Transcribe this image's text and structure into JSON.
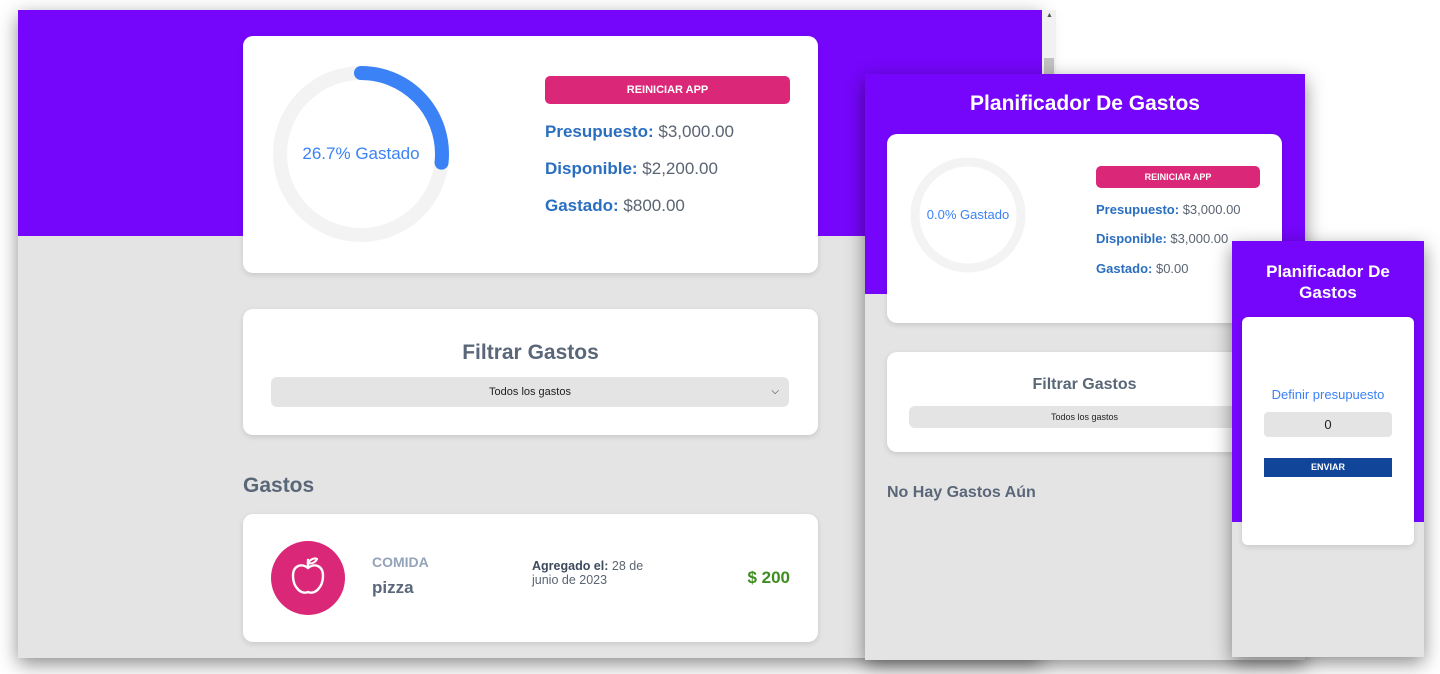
{
  "desktop": {
    "progress_fraction": 0.267,
    "progress_label": "26.7% Gastado",
    "reset_button": "REINICIAR APP",
    "budget_label": "Presupuesto:",
    "budget_value": "$3,000.00",
    "available_label": "Disponible:",
    "available_value": "$2,200.00",
    "spent_label": "Gastado:",
    "spent_value": "$800.00",
    "filter_title": "Filtrar Gastos",
    "filter_selected": "Todos los gastos",
    "expenses_title": "Gastos",
    "expense": {
      "category": "COMIDA",
      "name": "pizza",
      "date_label": "Agregado el:",
      "date_value": "28 de junio de 2023",
      "amount": "$ 200"
    }
  },
  "tablet": {
    "title": "Planificador De Gastos",
    "progress_fraction": 0.0,
    "progress_label": "0.0% Gastado",
    "reset_button": "REINICIAR APP",
    "budget_label": "Presupuesto:",
    "budget_value": "$3,000.00",
    "available_label": "Disponible:",
    "available_value": "$3,000.00",
    "spent_label": "Gastado:",
    "spent_value": "$0.00",
    "filter_title": "Filtrar Gastos",
    "filter_selected": "Todos los gastos",
    "empty_message": "No Hay Gastos Aún"
  },
  "mobile": {
    "title": "Planificador De Gastos",
    "budget_prompt": "Definir presupuesto",
    "budget_input_value": "0",
    "submit_button": "ENVIAR"
  },
  "colors": {
    "hero": "#7506fb",
    "accent_pink": "#db2777",
    "progress_blue": "#3b82f6",
    "label_blue": "#2a6ebf",
    "amount_green": "#3f8c1f",
    "submit_navy": "#10459a"
  }
}
